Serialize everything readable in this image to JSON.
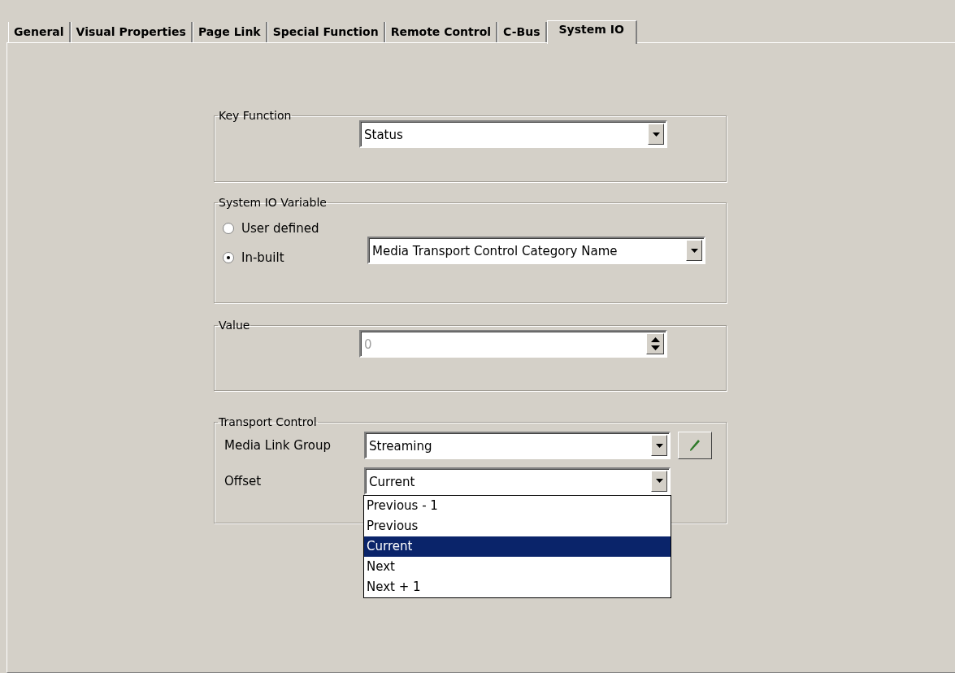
{
  "tabs": [
    {
      "label": "General",
      "selected": false
    },
    {
      "label": "Visual Properties",
      "selected": false
    },
    {
      "label": "Page Link",
      "selected": false
    },
    {
      "label": "Special Function",
      "selected": false
    },
    {
      "label": "Remote Control",
      "selected": false
    },
    {
      "label": "C-Bus",
      "selected": false
    },
    {
      "label": "System IO",
      "selected": true
    }
  ],
  "key_function": {
    "title": "Key Function",
    "value": "Status"
  },
  "system_io_variable": {
    "title": "System IO Variable",
    "options": [
      {
        "label": "User defined",
        "selected": false
      },
      {
        "label": "In-built",
        "selected": true
      }
    ],
    "inbuilt_value": "Media Transport Control Category Name"
  },
  "value": {
    "title": "Value",
    "value": "0",
    "disabled": true
  },
  "transport_control": {
    "title": "Transport Control",
    "media_link_group": {
      "label": "Media Link Group",
      "value": "Streaming"
    },
    "offset": {
      "label": "Offset",
      "value": "Current",
      "expanded": true,
      "options": [
        {
          "label": "Previous - 1",
          "selected": false
        },
        {
          "label": "Previous",
          "selected": false
        },
        {
          "label": "Current",
          "selected": true
        },
        {
          "label": "Next",
          "selected": false
        },
        {
          "label": "Next + 1",
          "selected": false
        }
      ]
    }
  }
}
